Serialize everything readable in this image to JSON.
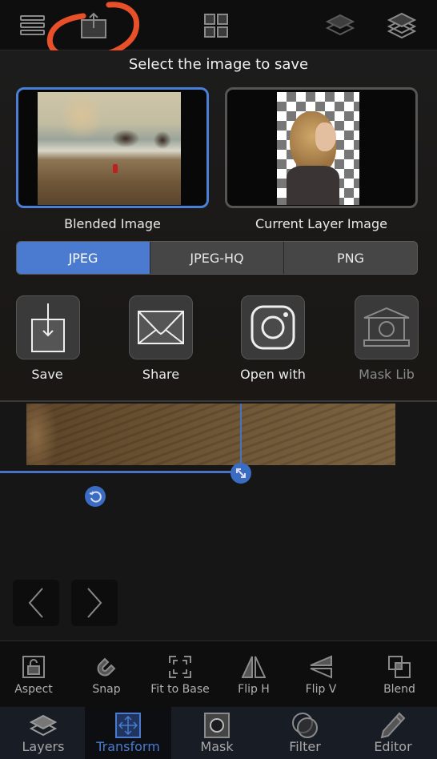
{
  "toolbar": {
    "icons": [
      "menu-list-icon",
      "export-share-icon",
      "grid-icon",
      "layer-single-icon",
      "layers-stack-icon"
    ],
    "annotation_color": "#e8502a"
  },
  "save_dialog": {
    "title": "Select the image to save",
    "options": [
      {
        "label": "Blended Image",
        "selected": true
      },
      {
        "label": "Current Layer Image",
        "selected": false
      }
    ],
    "formats": [
      {
        "label": "JPEG",
        "active": true
      },
      {
        "label": "JPEG-HQ",
        "active": false
      },
      {
        "label": "PNG",
        "active": false
      }
    ],
    "actions": [
      {
        "label": "Save",
        "icon": "save-download-icon",
        "enabled": true
      },
      {
        "label": "Share",
        "icon": "envelope-icon",
        "enabled": true
      },
      {
        "label": "Open with",
        "icon": "instagram-icon",
        "enabled": true
      },
      {
        "label": "Mask Lib",
        "icon": "museum-icon",
        "enabled": false
      }
    ]
  },
  "canvas": {
    "nav_prev": "previous",
    "nav_next": "next"
  },
  "transform_tools": [
    {
      "label": "Aspect",
      "icon": "lock-icon"
    },
    {
      "label": "Snap",
      "icon": "magnet-icon"
    },
    {
      "label": "Fit to Base",
      "icon": "fit-frame-icon"
    },
    {
      "label": "Flip H",
      "icon": "flip-horizontal-icon"
    },
    {
      "label": "Flip V",
      "icon": "flip-vertical-icon"
    },
    {
      "label": "Blend",
      "icon": "blend-squares-icon"
    }
  ],
  "tabs": [
    {
      "label": "Layers",
      "active": false
    },
    {
      "label": "Transform",
      "active": true
    },
    {
      "label": "Mask",
      "active": false
    },
    {
      "label": "Filter",
      "active": false
    },
    {
      "label": "Editor",
      "active": false
    }
  ],
  "colors": {
    "accent": "#4a7bd0",
    "background": "#161616"
  }
}
